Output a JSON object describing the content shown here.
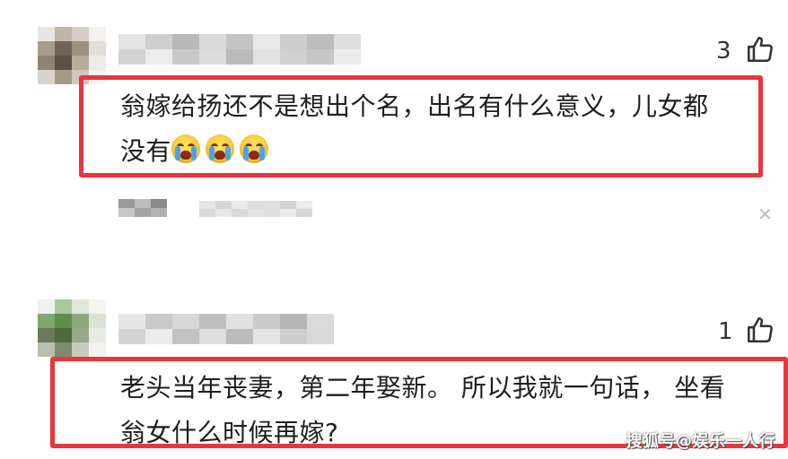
{
  "comments": [
    {
      "like_count": "3",
      "text_line1": "翁嫁给扬还不是想出个名，出名有什么意义，儿女都",
      "text_line2": "没有"
    },
    {
      "like_count": "1",
      "text_line1": "老头当年丧妻，第二年娶新。 所以我就一句话， 坐看",
      "text_line2": "翁女什么时候再嫁?"
    }
  ],
  "emoji_name": "crying-face-emoji",
  "icons": {
    "like": "thumbs-up-icon",
    "close": "close-icon"
  },
  "colors": {
    "highlight_border": "#e8363c",
    "text": "#1e1e1e"
  },
  "watermark": "搜狐号@娱乐一人行"
}
